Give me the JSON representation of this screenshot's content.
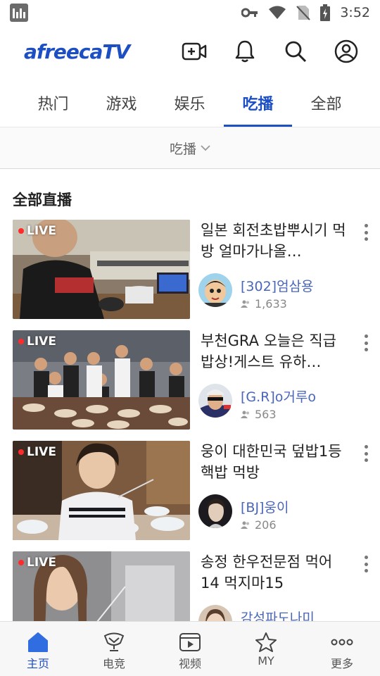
{
  "status_bar": {
    "time": "3:52"
  },
  "header": {
    "logo": "afreecaTV"
  },
  "tabs": [
    {
      "label": "热门",
      "active": false
    },
    {
      "label": "游戏",
      "active": false
    },
    {
      "label": "娱乐",
      "active": false
    },
    {
      "label": "吃播",
      "active": true
    },
    {
      "label": "全部",
      "active": false
    }
  ],
  "filter": {
    "label": "吃播"
  },
  "section": {
    "title": "全部直播"
  },
  "streams": [
    {
      "live_badge": "LIVE",
      "title": "일본 회전초밥뿌시기 먹방 얼마가나올…",
      "streamer": "[302]엄삼용",
      "viewers": "1,633"
    },
    {
      "live_badge": "LIVE",
      "title": "부천GRA 오늘은 직급밥상!게스트 유하…",
      "streamer": "[G.R]o거루o",
      "viewers": "563"
    },
    {
      "live_badge": "LIVE",
      "title": "웅이 대한민국 덮밥1등 핵밥 먹방",
      "streamer": "[BJ]웅이",
      "viewers": "206"
    },
    {
      "live_badge": "LIVE",
      "title": "송정 한우전문점 먹어14 먹지마15",
      "streamer": "감성파도나미",
      "viewers": ""
    }
  ],
  "bottom_nav": [
    {
      "label": "主页",
      "icon": "home-icon",
      "active": true
    },
    {
      "label": "电竞",
      "icon": "trophy-icon",
      "active": false
    },
    {
      "label": "视频",
      "icon": "video-icon",
      "active": false
    },
    {
      "label": "MY",
      "icon": "star-icon",
      "active": false
    },
    {
      "label": "更多",
      "icon": "more-dots-icon",
      "active": false
    }
  ],
  "colors": {
    "accent": "#1c4fc4",
    "live_dot": "#ff2b2b",
    "streamer_name": "#4a66b8"
  }
}
